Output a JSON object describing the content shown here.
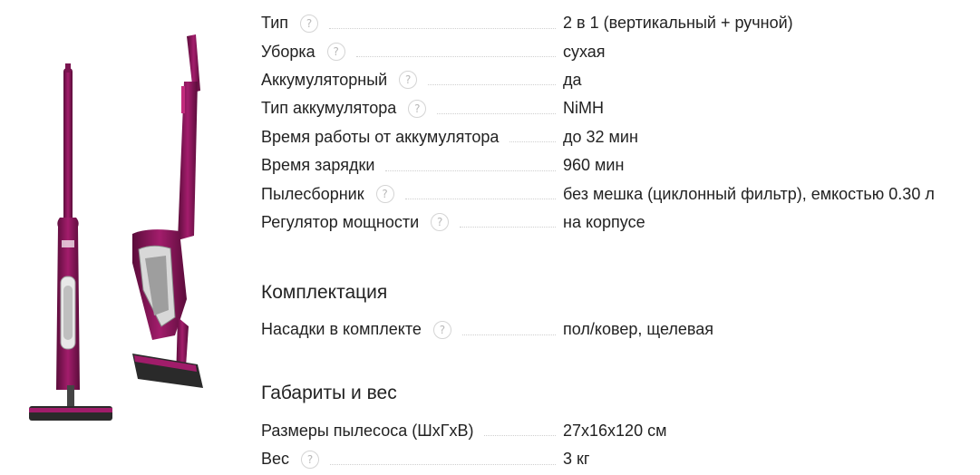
{
  "main": {
    "rows": [
      {
        "label": "Тип",
        "value": "2 в 1 (вертикальный + ручной)"
      },
      {
        "label": "Уборка",
        "value": "сухая"
      },
      {
        "label": "Аккумуляторный",
        "value": "да"
      },
      {
        "label": "Тип аккумулятора",
        "value": "NiMH"
      },
      {
        "label": "Время работы от аккумулятора",
        "value": "до 32 мин"
      },
      {
        "label": "Время зарядки",
        "value": "960 мин"
      },
      {
        "label": "Пылесборник",
        "value": "без мешка (циклонный фильтр), емкостью 0.30 л"
      },
      {
        "label": "Регулятор мощности",
        "value": "на корпусе"
      }
    ]
  },
  "complectation": {
    "title": "Комплектация",
    "rows": [
      {
        "label": "Насадки в комплекте",
        "value": "пол/ковер, щелевая"
      }
    ]
  },
  "dimensions": {
    "title": "Габариты и вес",
    "rows": [
      {
        "label": "Размеры пылесоса (ШхГхВ)",
        "value": "27х16х120 см"
      },
      {
        "label": "Вес",
        "value": "3 кг"
      }
    ]
  },
  "help_glyph": "?",
  "colors": {
    "body": "#7a1450",
    "accent": "#a01c6a",
    "dark": "#2a2a2a"
  },
  "icons": {
    "help": "question-circle-icon",
    "product": "bosch-vacuum-cleaner-image"
  }
}
